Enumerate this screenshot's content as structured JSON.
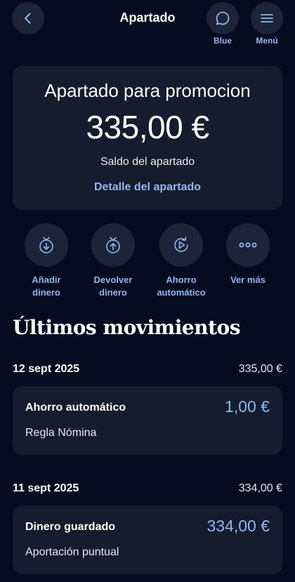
{
  "header": {
    "title": "Apartado",
    "blue_label": "Blue",
    "menu_label": "Menú",
    "icons": [
      "chevron-left-icon",
      "chat-bubble-icon",
      "hamburger-menu-icon"
    ]
  },
  "balance": {
    "title": "Apartado para promocion",
    "amount": "335,00 €",
    "subtitle": "Saldo del apartado",
    "link": "Detalle del apartado"
  },
  "actions": [
    {
      "label": "Añadir\ndinero",
      "icon": "add-money-icon"
    },
    {
      "label": "Devolver\ndinero",
      "icon": "return-money-icon"
    },
    {
      "label": "Ahorro\nautomático",
      "icon": "auto-save-icon"
    },
    {
      "label": "Ver más",
      "icon": "more-dots-icon"
    }
  ],
  "movements": {
    "title": "Últimos movimientos",
    "groups": [
      {
        "date": "12 sept 2025",
        "total": "335,00 €",
        "items": [
          {
            "name": "Ahorro automático",
            "amount": "1,00 €",
            "detail": "Regla Nómina"
          }
        ]
      },
      {
        "date": "11 sept 2025",
        "total": "334,00 €",
        "items": [
          {
            "name": "Dinero guardado",
            "amount": "334,00 €",
            "detail": "Aportación puntual"
          }
        ]
      }
    ]
  },
  "colors": {
    "background": "#050c1f",
    "card": "#151c2e",
    "accent": "#8fb6ee"
  }
}
